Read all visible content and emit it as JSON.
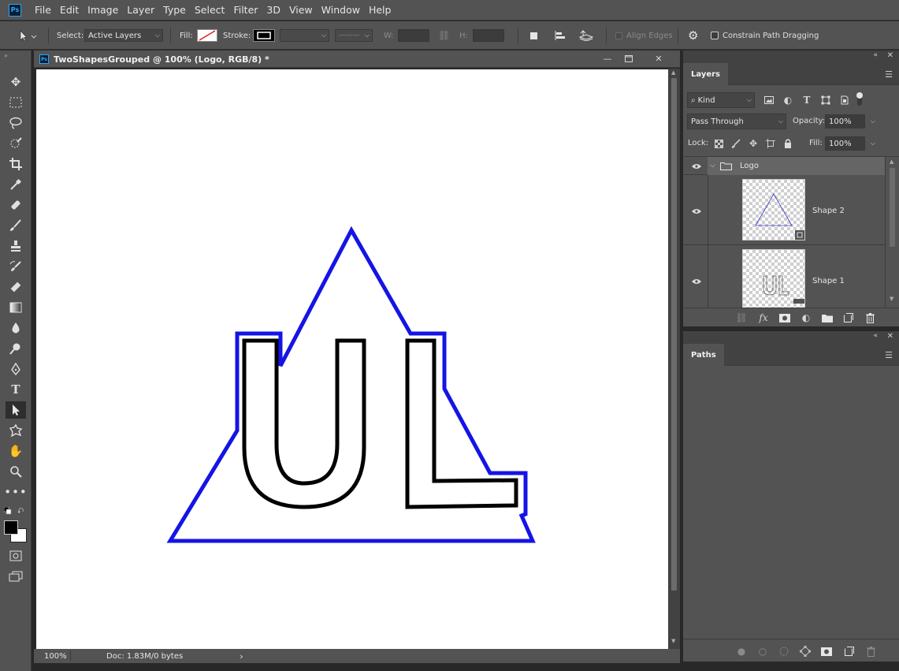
{
  "app": {
    "logo": "Ps"
  },
  "menu": [
    "File",
    "Edit",
    "Image",
    "Layer",
    "Type",
    "Select",
    "Filter",
    "3D",
    "View",
    "Window",
    "Help"
  ],
  "options": {
    "select_label": "Select:",
    "select_value": "Active Layers",
    "fill_label": "Fill:",
    "stroke_label": "Stroke:",
    "w_label": "W:",
    "h_label": "H:",
    "align_edges": "Align Edges",
    "constrain": "Constrain Path Dragging"
  },
  "document": {
    "tab_title": "TwoShapesGrouped @ 100% (Logo, RGB/8) *",
    "zoom": "100%",
    "doc_info": "Doc: 1.83M/0 bytes"
  },
  "canvas_colors": {
    "triangle_stroke": "#1414e6",
    "letters_stroke": "#000000"
  },
  "layers_panel": {
    "tab": "Layers",
    "filter_kind": "Kind",
    "blend_mode": "Pass Through",
    "opacity_label": "Opacity:",
    "opacity_value": "100%",
    "lock_label": "Lock:",
    "fill_label": "Fill:",
    "fill_value": "100%",
    "group_name": "Logo",
    "layers": [
      {
        "name": "Shape 2"
      },
      {
        "name": "Shape 1"
      }
    ]
  },
  "paths_panel": {
    "tab": "Paths"
  }
}
